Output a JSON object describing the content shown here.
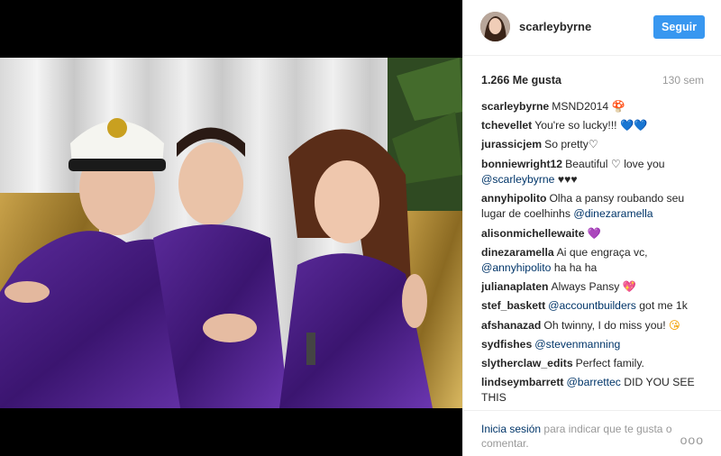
{
  "header": {
    "username": "scarleybyrne",
    "follow_label": "Seguir"
  },
  "meta": {
    "likes": "1.266 Me gusta",
    "time": "130 sem"
  },
  "comments": [
    {
      "user": "scarleybyrne",
      "text": "MSND2014",
      "emoji": "🍄",
      "emoji_class": "mushroom"
    },
    {
      "user": "tchevellet",
      "text": "You're so lucky!!!",
      "emoji": "💙💙",
      "emoji_class": "heart"
    },
    {
      "user": "jurassicjem",
      "text": "So pretty♡",
      "emoji": "",
      "emoji_class": ""
    },
    {
      "user": "bonniewright12",
      "text": "Beautiful ♡ love you",
      "mention": "@scarleybyrne",
      "after": "♥♥♥"
    },
    {
      "user": "annyhipolito",
      "text": "Olha a pansy roubando seu lugar de coelhinhs",
      "mention": "@dinezaramella",
      "after": ""
    },
    {
      "user": "alisonmichellewaite",
      "text": "",
      "emoji": "💜",
      "emoji_class": "purple-heart"
    },
    {
      "user": "dinezaramella",
      "text": "Ai que engraça vc,",
      "mention": "@annyhipolito",
      "after": "ha ha ha"
    },
    {
      "user": "julianaplaten",
      "text": "Always Pansy",
      "emoji": "💖",
      "emoji_class": "pink-heart"
    },
    {
      "user": "stef_baskett",
      "text": "",
      "mention": "@accountbuilders",
      "after": "got me 1k"
    },
    {
      "user": "afshanazad",
      "text": "Oh twinny, I do miss you!",
      "emoji": "😘",
      "emoji_class": "blush"
    },
    {
      "user": "sydfishes",
      "text": "",
      "mention": "@stevenmanning",
      "after": ""
    },
    {
      "user": "slytherclaw_edits",
      "text": "Perfect family.",
      "emoji": "",
      "emoji_class": ""
    },
    {
      "user": "lindseymbarrett",
      "text": "",
      "mention": "@barrettec",
      "after": "DID YOU SEE THIS"
    }
  ],
  "footer": {
    "login_link": "Inicia sesión",
    "login_rest": "para indicar que te gusta o comentar.",
    "more_icon": "more-options-icon",
    "more_glyph": "ooo"
  }
}
